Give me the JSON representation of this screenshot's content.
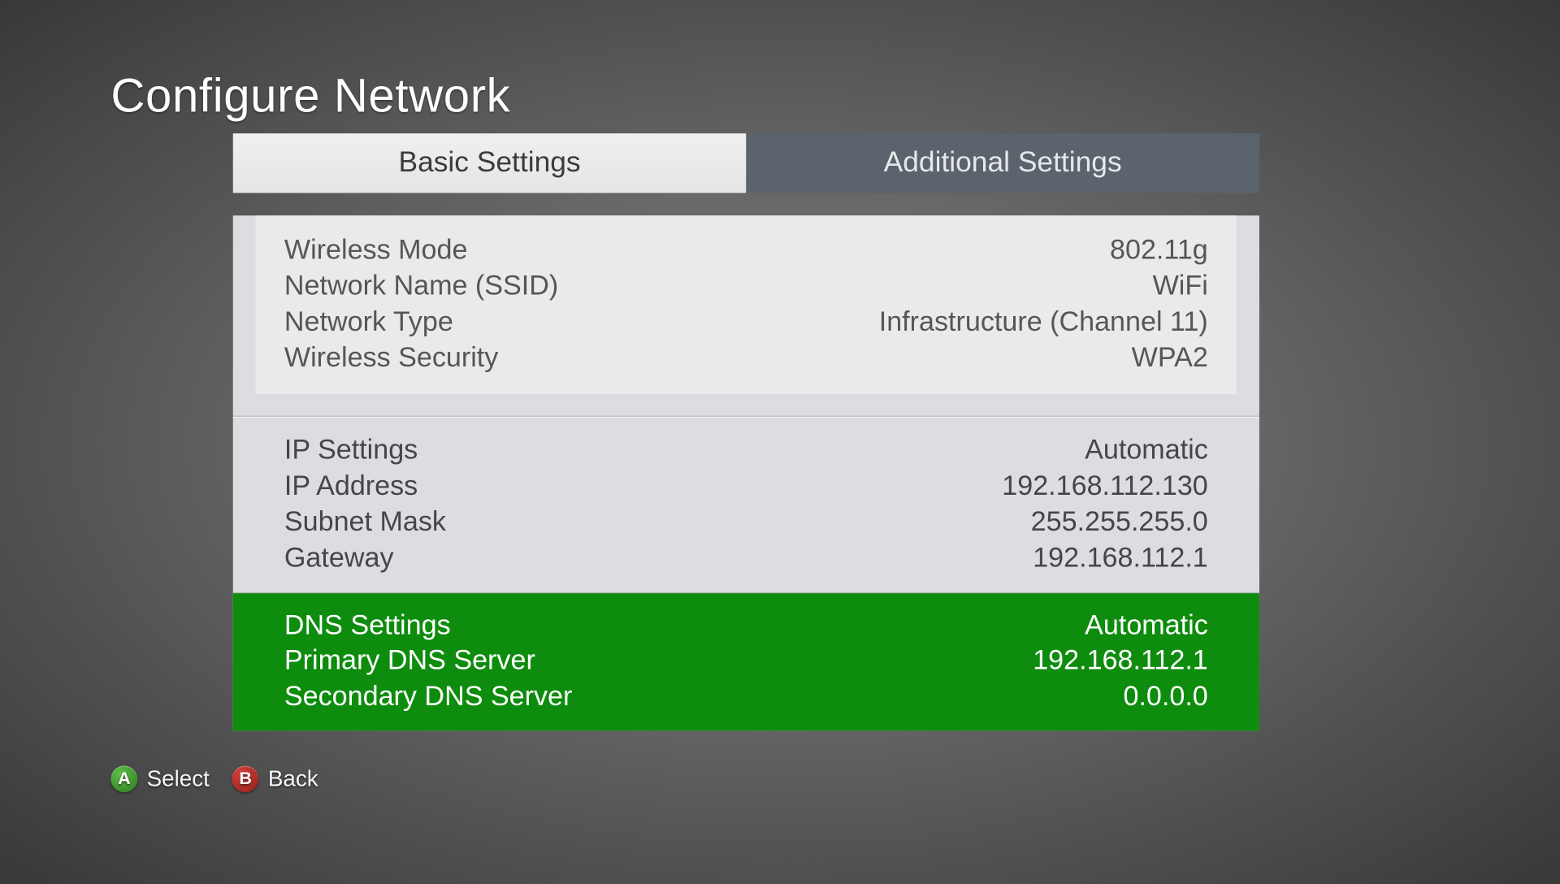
{
  "title": "Configure Network",
  "tabs": {
    "basic": "Basic Settings",
    "additional": "Additional Settings"
  },
  "wireless": {
    "mode_label": "Wireless Mode",
    "mode_value": "802.11g",
    "ssid_label": "Network Name (SSID)",
    "ssid_value": "WiFi",
    "type_label": "Network Type",
    "type_value": "Infrastructure (Channel 11)",
    "security_label": "Wireless Security",
    "security_value": "WPA2"
  },
  "ip": {
    "settings_label": "IP Settings",
    "settings_value": "Automatic",
    "address_label": "IP Address",
    "address_value": "192.168.112.130",
    "subnet_label": "Subnet Mask",
    "subnet_value": "255.255.255.0",
    "gateway_label": "Gateway",
    "gateway_value": "192.168.112.1"
  },
  "dns": {
    "settings_label": "DNS Settings",
    "settings_value": "Automatic",
    "primary_label": "Primary DNS Server",
    "primary_value": "192.168.112.1",
    "secondary_label": "Secondary DNS Server",
    "secondary_value": "0.0.0.0"
  },
  "footer": {
    "a_letter": "A",
    "a_label": "Select",
    "b_letter": "B",
    "b_label": "Back"
  }
}
